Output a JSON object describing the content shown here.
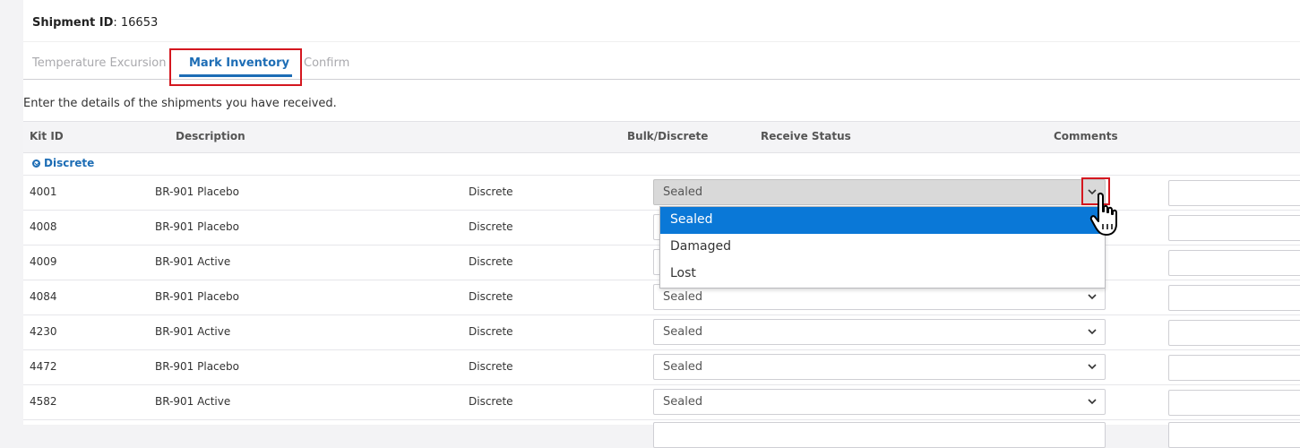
{
  "shipment": {
    "label": "Shipment ID",
    "value": ": 16653"
  },
  "tabs": [
    {
      "label": "Temperature Excursion",
      "active": false
    },
    {
      "label": "Mark Inventory",
      "active": true
    },
    {
      "label": "Confirm",
      "active": false
    }
  ],
  "instructions": "Enter the details of the shipments you have received.",
  "table": {
    "headers": {
      "kit_id": "Kit ID",
      "description": "Description",
      "bulk_discrete": "Bulk/Discrete",
      "receive_status": "Receive Status",
      "comments": "Comments"
    },
    "group": "Discrete",
    "rows": [
      {
        "kit_id": "4001",
        "description": "BR-901 Placebo",
        "type": "Discrete",
        "status": "Sealed"
      },
      {
        "kit_id": "4008",
        "description": "BR-901 Placebo",
        "type": "Discrete",
        "status": ""
      },
      {
        "kit_id": "4009",
        "description": "BR-901 Active",
        "type": "Discrete",
        "status": ""
      },
      {
        "kit_id": "4084",
        "description": "BR-901 Placebo",
        "type": "Discrete",
        "status": "Sealed"
      },
      {
        "kit_id": "4230",
        "description": "BR-901 Active",
        "type": "Discrete",
        "status": "Sealed"
      },
      {
        "kit_id": "4472",
        "description": "BR-901 Placebo",
        "type": "Discrete",
        "status": "Sealed"
      },
      {
        "kit_id": "4582",
        "description": "BR-901 Active",
        "type": "Discrete",
        "status": "Sealed"
      }
    ]
  },
  "dropdown": {
    "options": [
      "Sealed",
      "Damaged",
      "Lost"
    ],
    "selected": "Sealed"
  },
  "icons": {
    "group_toggle": "chevron-circle-down-icon",
    "select_chevron": "chevron-down-icon",
    "cursor": "hand-pointer-icon"
  },
  "colors": {
    "accent": "#1d6db5",
    "highlight": "#d4171f",
    "dropdown_selected": "#0a78d7"
  }
}
